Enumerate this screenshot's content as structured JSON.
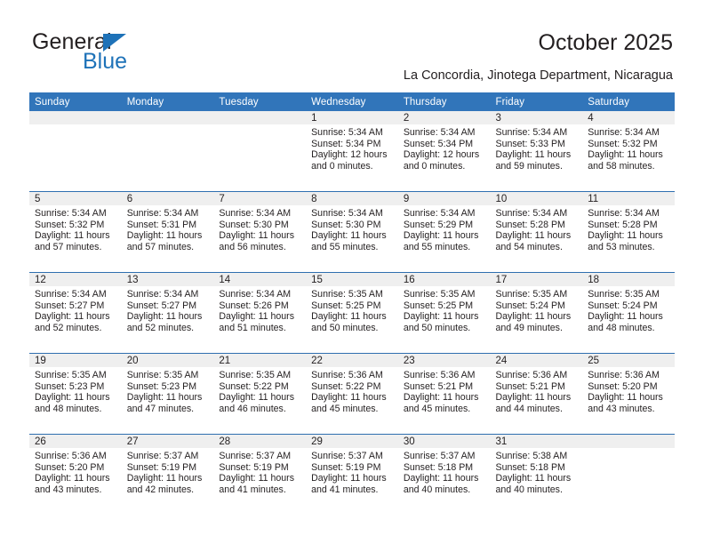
{
  "brand": {
    "name_top": "General",
    "name_bottom": "Blue",
    "accent_color": "#1e72b8",
    "text_color": "#231f20"
  },
  "header": {
    "title": "October 2025",
    "subtitle": "La Concordia, Jinotega Department, Nicaragua"
  },
  "calendar": {
    "header_bg": "#3175ba",
    "header_text_color": "#ffffff",
    "daynum_band_bg": "#efefef",
    "week_separator_color": "#2f6fb0",
    "weekdays": [
      "Sunday",
      "Monday",
      "Tuesday",
      "Wednesday",
      "Thursday",
      "Friday",
      "Saturday"
    ],
    "weeks": [
      [
        {
          "day": "",
          "sunrise": "",
          "sunset": "",
          "daylight_l1": "",
          "daylight_l2": ""
        },
        {
          "day": "",
          "sunrise": "",
          "sunset": "",
          "daylight_l1": "",
          "daylight_l2": ""
        },
        {
          "day": "",
          "sunrise": "",
          "sunset": "",
          "daylight_l1": "",
          "daylight_l2": ""
        },
        {
          "day": "1",
          "sunrise": "Sunrise: 5:34 AM",
          "sunset": "Sunset: 5:34 PM",
          "daylight_l1": "Daylight: 12 hours",
          "daylight_l2": "and 0 minutes."
        },
        {
          "day": "2",
          "sunrise": "Sunrise: 5:34 AM",
          "sunset": "Sunset: 5:34 PM",
          "daylight_l1": "Daylight: 12 hours",
          "daylight_l2": "and 0 minutes."
        },
        {
          "day": "3",
          "sunrise": "Sunrise: 5:34 AM",
          "sunset": "Sunset: 5:33 PM",
          "daylight_l1": "Daylight: 11 hours",
          "daylight_l2": "and 59 minutes."
        },
        {
          "day": "4",
          "sunrise": "Sunrise: 5:34 AM",
          "sunset": "Sunset: 5:32 PM",
          "daylight_l1": "Daylight: 11 hours",
          "daylight_l2": "and 58 minutes."
        }
      ],
      [
        {
          "day": "5",
          "sunrise": "Sunrise: 5:34 AM",
          "sunset": "Sunset: 5:32 PM",
          "daylight_l1": "Daylight: 11 hours",
          "daylight_l2": "and 57 minutes."
        },
        {
          "day": "6",
          "sunrise": "Sunrise: 5:34 AM",
          "sunset": "Sunset: 5:31 PM",
          "daylight_l1": "Daylight: 11 hours",
          "daylight_l2": "and 57 minutes."
        },
        {
          "day": "7",
          "sunrise": "Sunrise: 5:34 AM",
          "sunset": "Sunset: 5:30 PM",
          "daylight_l1": "Daylight: 11 hours",
          "daylight_l2": "and 56 minutes."
        },
        {
          "day": "8",
          "sunrise": "Sunrise: 5:34 AM",
          "sunset": "Sunset: 5:30 PM",
          "daylight_l1": "Daylight: 11 hours",
          "daylight_l2": "and 55 minutes."
        },
        {
          "day": "9",
          "sunrise": "Sunrise: 5:34 AM",
          "sunset": "Sunset: 5:29 PM",
          "daylight_l1": "Daylight: 11 hours",
          "daylight_l2": "and 55 minutes."
        },
        {
          "day": "10",
          "sunrise": "Sunrise: 5:34 AM",
          "sunset": "Sunset: 5:28 PM",
          "daylight_l1": "Daylight: 11 hours",
          "daylight_l2": "and 54 minutes."
        },
        {
          "day": "11",
          "sunrise": "Sunrise: 5:34 AM",
          "sunset": "Sunset: 5:28 PM",
          "daylight_l1": "Daylight: 11 hours",
          "daylight_l2": "and 53 minutes."
        }
      ],
      [
        {
          "day": "12",
          "sunrise": "Sunrise: 5:34 AM",
          "sunset": "Sunset: 5:27 PM",
          "daylight_l1": "Daylight: 11 hours",
          "daylight_l2": "and 52 minutes."
        },
        {
          "day": "13",
          "sunrise": "Sunrise: 5:34 AM",
          "sunset": "Sunset: 5:27 PM",
          "daylight_l1": "Daylight: 11 hours",
          "daylight_l2": "and 52 minutes."
        },
        {
          "day": "14",
          "sunrise": "Sunrise: 5:34 AM",
          "sunset": "Sunset: 5:26 PM",
          "daylight_l1": "Daylight: 11 hours",
          "daylight_l2": "and 51 minutes."
        },
        {
          "day": "15",
          "sunrise": "Sunrise: 5:35 AM",
          "sunset": "Sunset: 5:25 PM",
          "daylight_l1": "Daylight: 11 hours",
          "daylight_l2": "and 50 minutes."
        },
        {
          "day": "16",
          "sunrise": "Sunrise: 5:35 AM",
          "sunset": "Sunset: 5:25 PM",
          "daylight_l1": "Daylight: 11 hours",
          "daylight_l2": "and 50 minutes."
        },
        {
          "day": "17",
          "sunrise": "Sunrise: 5:35 AM",
          "sunset": "Sunset: 5:24 PM",
          "daylight_l1": "Daylight: 11 hours",
          "daylight_l2": "and 49 minutes."
        },
        {
          "day": "18",
          "sunrise": "Sunrise: 5:35 AM",
          "sunset": "Sunset: 5:24 PM",
          "daylight_l1": "Daylight: 11 hours",
          "daylight_l2": "and 48 minutes."
        }
      ],
      [
        {
          "day": "19",
          "sunrise": "Sunrise: 5:35 AM",
          "sunset": "Sunset: 5:23 PM",
          "daylight_l1": "Daylight: 11 hours",
          "daylight_l2": "and 48 minutes."
        },
        {
          "day": "20",
          "sunrise": "Sunrise: 5:35 AM",
          "sunset": "Sunset: 5:23 PM",
          "daylight_l1": "Daylight: 11 hours",
          "daylight_l2": "and 47 minutes."
        },
        {
          "day": "21",
          "sunrise": "Sunrise: 5:35 AM",
          "sunset": "Sunset: 5:22 PM",
          "daylight_l1": "Daylight: 11 hours",
          "daylight_l2": "and 46 minutes."
        },
        {
          "day": "22",
          "sunrise": "Sunrise: 5:36 AM",
          "sunset": "Sunset: 5:22 PM",
          "daylight_l1": "Daylight: 11 hours",
          "daylight_l2": "and 45 minutes."
        },
        {
          "day": "23",
          "sunrise": "Sunrise: 5:36 AM",
          "sunset": "Sunset: 5:21 PM",
          "daylight_l1": "Daylight: 11 hours",
          "daylight_l2": "and 45 minutes."
        },
        {
          "day": "24",
          "sunrise": "Sunrise: 5:36 AM",
          "sunset": "Sunset: 5:21 PM",
          "daylight_l1": "Daylight: 11 hours",
          "daylight_l2": "and 44 minutes."
        },
        {
          "day": "25",
          "sunrise": "Sunrise: 5:36 AM",
          "sunset": "Sunset: 5:20 PM",
          "daylight_l1": "Daylight: 11 hours",
          "daylight_l2": "and 43 minutes."
        }
      ],
      [
        {
          "day": "26",
          "sunrise": "Sunrise: 5:36 AM",
          "sunset": "Sunset: 5:20 PM",
          "daylight_l1": "Daylight: 11 hours",
          "daylight_l2": "and 43 minutes."
        },
        {
          "day": "27",
          "sunrise": "Sunrise: 5:37 AM",
          "sunset": "Sunset: 5:19 PM",
          "daylight_l1": "Daylight: 11 hours",
          "daylight_l2": "and 42 minutes."
        },
        {
          "day": "28",
          "sunrise": "Sunrise: 5:37 AM",
          "sunset": "Sunset: 5:19 PM",
          "daylight_l1": "Daylight: 11 hours",
          "daylight_l2": "and 41 minutes."
        },
        {
          "day": "29",
          "sunrise": "Sunrise: 5:37 AM",
          "sunset": "Sunset: 5:19 PM",
          "daylight_l1": "Daylight: 11 hours",
          "daylight_l2": "and 41 minutes."
        },
        {
          "day": "30",
          "sunrise": "Sunrise: 5:37 AM",
          "sunset": "Sunset: 5:18 PM",
          "daylight_l1": "Daylight: 11 hours",
          "daylight_l2": "and 40 minutes."
        },
        {
          "day": "31",
          "sunrise": "Sunrise: 5:38 AM",
          "sunset": "Sunset: 5:18 PM",
          "daylight_l1": "Daylight: 11 hours",
          "daylight_l2": "and 40 minutes."
        },
        {
          "day": "",
          "sunrise": "",
          "sunset": "",
          "daylight_l1": "",
          "daylight_l2": ""
        }
      ]
    ]
  }
}
